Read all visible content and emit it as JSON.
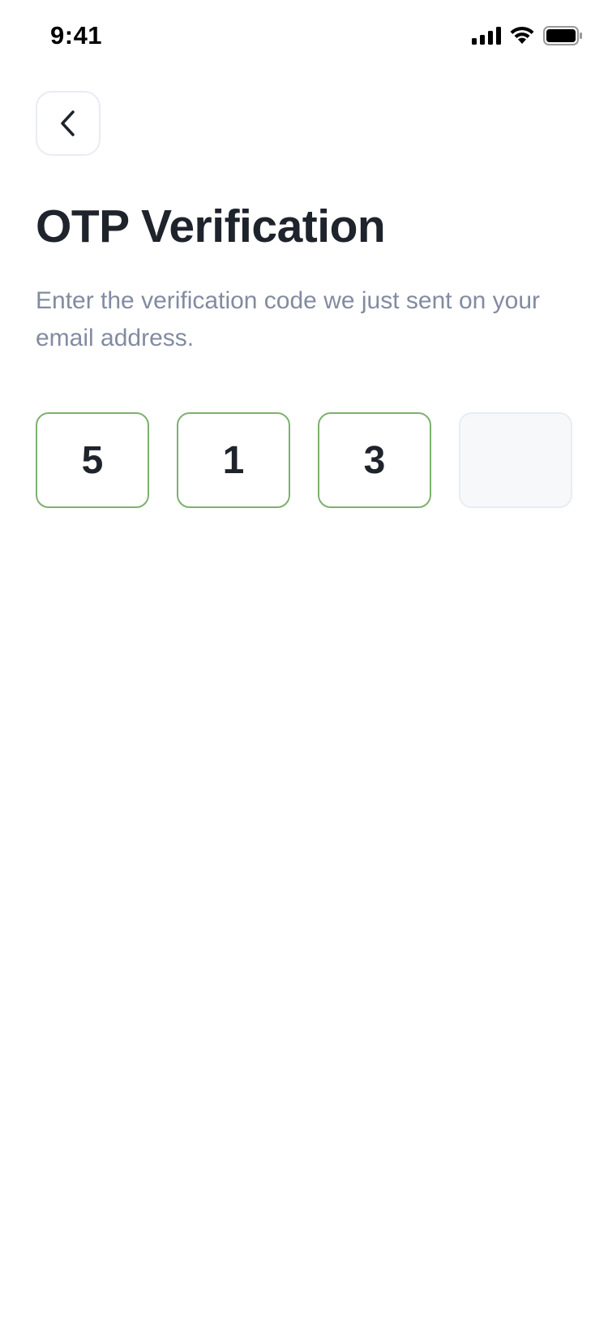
{
  "status_bar": {
    "time": "9:41"
  },
  "header": {
    "back_icon": "chevron-left-icon"
  },
  "title": "OTP Verification",
  "subtitle": "Enter the verification code we just sent on your email address.",
  "otp": {
    "digits": [
      "5",
      "1",
      "3",
      ""
    ],
    "filled_border_color": "#7DB06E",
    "empty_border_color": "#E8ECF4",
    "empty_background": "#F7F8F9"
  }
}
